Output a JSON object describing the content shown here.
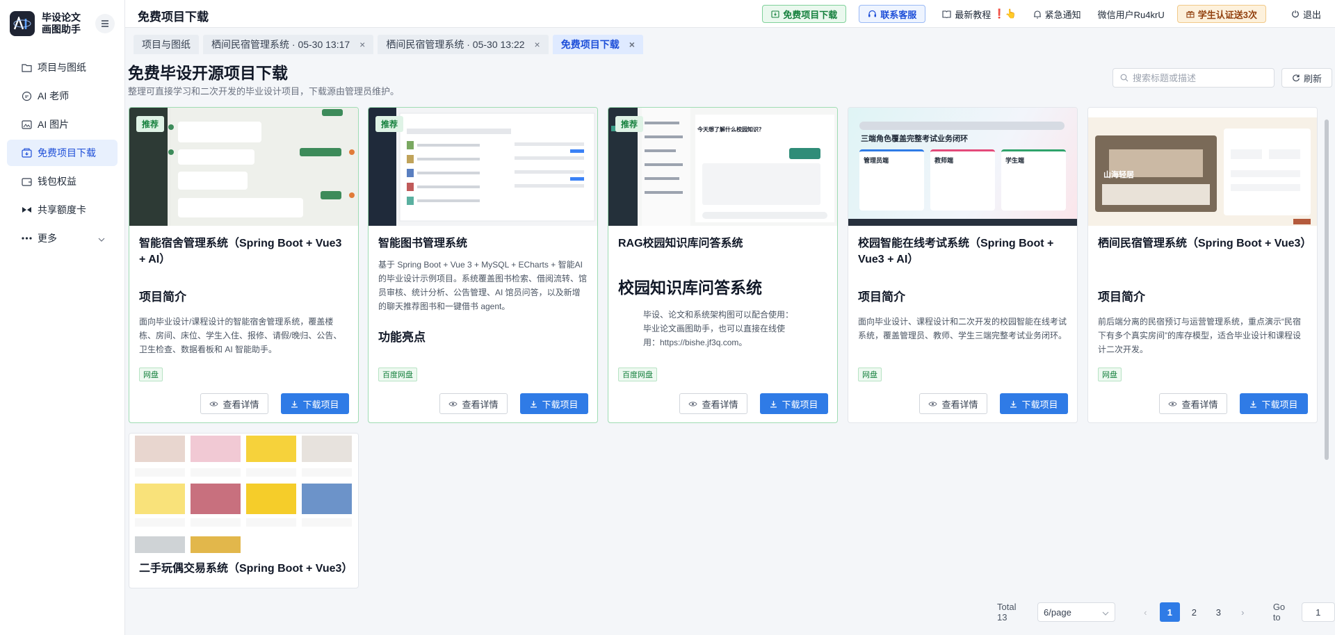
{
  "brand": {
    "name": "毕设论文画图助手",
    "logo_icon": "ai-logo-icon"
  },
  "sidebar": {
    "items": [
      {
        "label": "项目与图纸",
        "icon": "folder-icon"
      },
      {
        "label": "AI 老师",
        "icon": "chat-bubble-icon"
      },
      {
        "label": "AI 图片",
        "icon": "image-icon"
      },
      {
        "label": "免费项目下载",
        "icon": "download-box-icon",
        "active": true
      },
      {
        "label": "钱包权益",
        "icon": "wallet-icon"
      },
      {
        "label": "共享额度卡",
        "icon": "share-card-icon"
      },
      {
        "label": "更多",
        "icon": "more-dots-icon"
      }
    ]
  },
  "header": {
    "title": "免费项目下载",
    "free_download_label": "免费项目下载",
    "contact_label": "联系客服",
    "tutorial_label": "最新教程",
    "tutorial_badge": "❗👆",
    "notice_label": "紧急通知",
    "user_label": "微信用户Ru4krU",
    "student_label": "学生认证送3次",
    "logout_label": "退出"
  },
  "tabs": [
    {
      "label": "项目与图纸",
      "closable": false
    },
    {
      "label": "栖间民宿管理系统 · 05-30 13:17",
      "closable": true
    },
    {
      "label": "栖间民宿管理系统 · 05-30 13:22",
      "closable": true
    },
    {
      "label": "免费项目下载",
      "closable": true,
      "active": true
    }
  ],
  "content": {
    "title": "免费毕设开源项目下载",
    "subtitle": "整理可直接学习和二次开发的毕业设计项目，下载源由管理员维护。",
    "search_placeholder": "搜索标题或描述",
    "refresh_label": "刷新"
  },
  "card_actions": {
    "detail_label": "查看详情",
    "download_label": "下载项目",
    "recommend_label": "推荐"
  },
  "cards": [
    {
      "title": "智能宿舍管理系统（Spring Boot + Vue3 + AI）",
      "heading": "项目简介",
      "desc": "面向毕业设计/课程设计的智能宿舍管理系统，覆盖楼栋、房间、床位、学生入住、报修、请假/晚归、公告、卫生检查、数据看板和 AI 智能助手。",
      "tag": "网盘",
      "recommended": true
    },
    {
      "title": "智能图书管理系统",
      "heading": "功能亮点",
      "desc": "基于 Spring Boot + Vue 3 + MySQL + ECharts + 智能AI 的毕业设计示例项目。系统覆盖图书检索、借阅流转、馆员审核、统计分析、公告管理、AI 馆员问答，以及新增的聊天推荐图书和一键借书 agent。",
      "tag": "百度网盘",
      "recommended": true
    },
    {
      "title": "RAG校园知识库问答系统",
      "heading": "校园知识库问答系统",
      "desc": "毕设、论文和系统架构图可以配合使用：毕业论文画图助手，也可以直接在线使用：https://bishe.jf3q.com。",
      "tag": "百度网盘",
      "recommended": true
    },
    {
      "title": "校园智能在线考试系统（Spring Boot + Vue3 + AI）",
      "heading": "项目简介",
      "desc": "面向毕业设计、课程设计和二次开发的校园智能在线考试系统，覆盖管理员、教师、学生三端完整考试业务闭环。",
      "tag": "网盘",
      "recommended": false
    },
    {
      "title": "栖间民宿管理系统（Spring Boot + Vue3）",
      "heading": "项目简介",
      "desc": "前后端分离的民宿预订与运营管理系统，重点演示“民宿下有多个真实房间”的库存模型，适合毕业设计和课程设计二次开发。",
      "tag": "网盘",
      "recommended": false
    },
    {
      "title": "二手玩偶交易系统（Spring Boot + Vue3）",
      "heading": "",
      "desc": "",
      "tag": "",
      "recommended": false
    }
  ],
  "thumb_texts": {
    "exam_banner": "三端角色覆盖完整考试业务闭环",
    "exam_cols": [
      "管理员端",
      "教师端",
      "学生端"
    ],
    "homestay_name": "山海轻居",
    "rag_heading": "今天想了解什么校园知识？"
  },
  "pagination": {
    "total_label": "Total 13",
    "page_size": "6/page",
    "pages": [
      "1",
      "2",
      "3"
    ],
    "current": "1",
    "goto_label": "Go to",
    "goto_value": "1"
  },
  "colors": {
    "primary": "#2f7be6",
    "success": "#15803d",
    "sidebar_active_bg": "#e8f0fd"
  }
}
